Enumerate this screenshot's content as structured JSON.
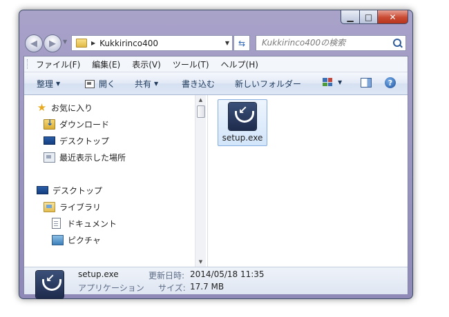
{
  "window": {
    "caption_buttons": {
      "minimize": "▁",
      "maximize": "□",
      "close": "✕"
    }
  },
  "navigation": {
    "breadcrumb": "Kukkirinco400",
    "search_placeholder": "Kukkirinco400の検索"
  },
  "menubar": {
    "items": [
      "ファイル(F)",
      "編集(E)",
      "表示(V)",
      "ツール(T)",
      "ヘルプ(H)"
    ]
  },
  "toolbar": {
    "organize": "整理",
    "open": "開く",
    "share": "共有",
    "burn": "書き込む",
    "new_folder": "新しいフォルダー"
  },
  "nav_pane": {
    "favorites": {
      "label": "お気に入り",
      "icon": "star-icon"
    },
    "favorites_items": [
      {
        "label": "ダウンロード",
        "icon": "downloads-folder-icon"
      },
      {
        "label": "デスクトップ",
        "icon": "desktop-icon"
      },
      {
        "label": "最近表示した場所",
        "icon": "recent-places-icon"
      }
    ],
    "desktop": {
      "label": "デスクトップ",
      "icon": "desktop-icon"
    },
    "libraries": {
      "label": "ライブラリ",
      "icon": "libraries-icon"
    },
    "library_items": [
      {
        "label": "ドキュメント",
        "icon": "documents-icon"
      },
      {
        "label": "ピクチャ",
        "icon": "pictures-icon"
      }
    ]
  },
  "files": [
    {
      "name": "setup.exe",
      "icon": "installer-icon",
      "selected": true
    }
  ],
  "details": {
    "name": "setup.exe",
    "type": "アプリケーション",
    "modified_label": "更新日時:",
    "modified_value": "2014/05/18 11:35",
    "size_label": "サイズ:",
    "size_value": "17.7 MB"
  },
  "colors": {
    "selection": "#d2e5fa",
    "window_frame": "#9d97c2",
    "close_button": "#c94a32"
  }
}
